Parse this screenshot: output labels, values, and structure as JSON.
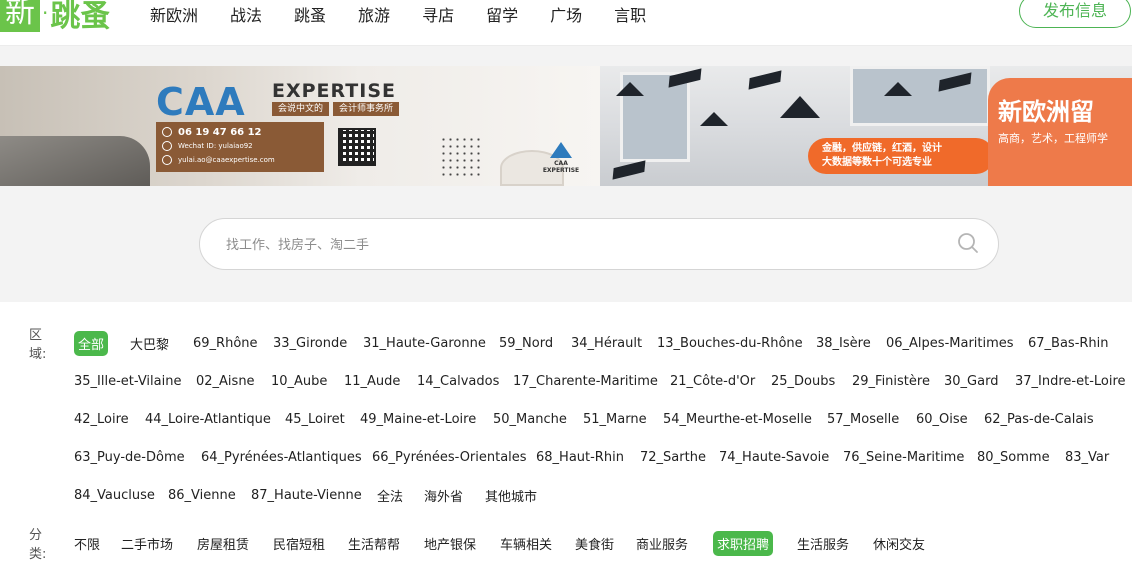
{
  "header": {
    "logo_main": "新",
    "logo_dot": "·",
    "logo_rest": "跳蚤",
    "nav": [
      "新欧洲",
      "战法",
      "跳蚤",
      "旅游",
      "寻店",
      "留学",
      "广场",
      "言职"
    ],
    "publish_label": "发布信息"
  },
  "banner": {
    "caa": "CAA",
    "expertise": "EXPERTISE",
    "tag1": "会说中文的",
    "tag2": "会计师事务所",
    "phone": "06 19 47 66 12",
    "wechat": "Wechat ID: yulaiao92",
    "email": "yulai.ao@caaexpertise.com",
    "small_logo": "CAA EXPERTISE",
    "pill_line1": "金融，供应链，红酒，设计",
    "pill_line2": "大数据等数十个可选专业",
    "title": "新欧洲留",
    "subtitle": "高商，艺术，工程师学",
    "accent": "#f06a2a"
  },
  "search": {
    "placeholder": "找工作、找房子、淘二手"
  },
  "filters": {
    "region_label": "区域:",
    "category_label": "分类:",
    "accent": "#4bb84b"
  }
}
